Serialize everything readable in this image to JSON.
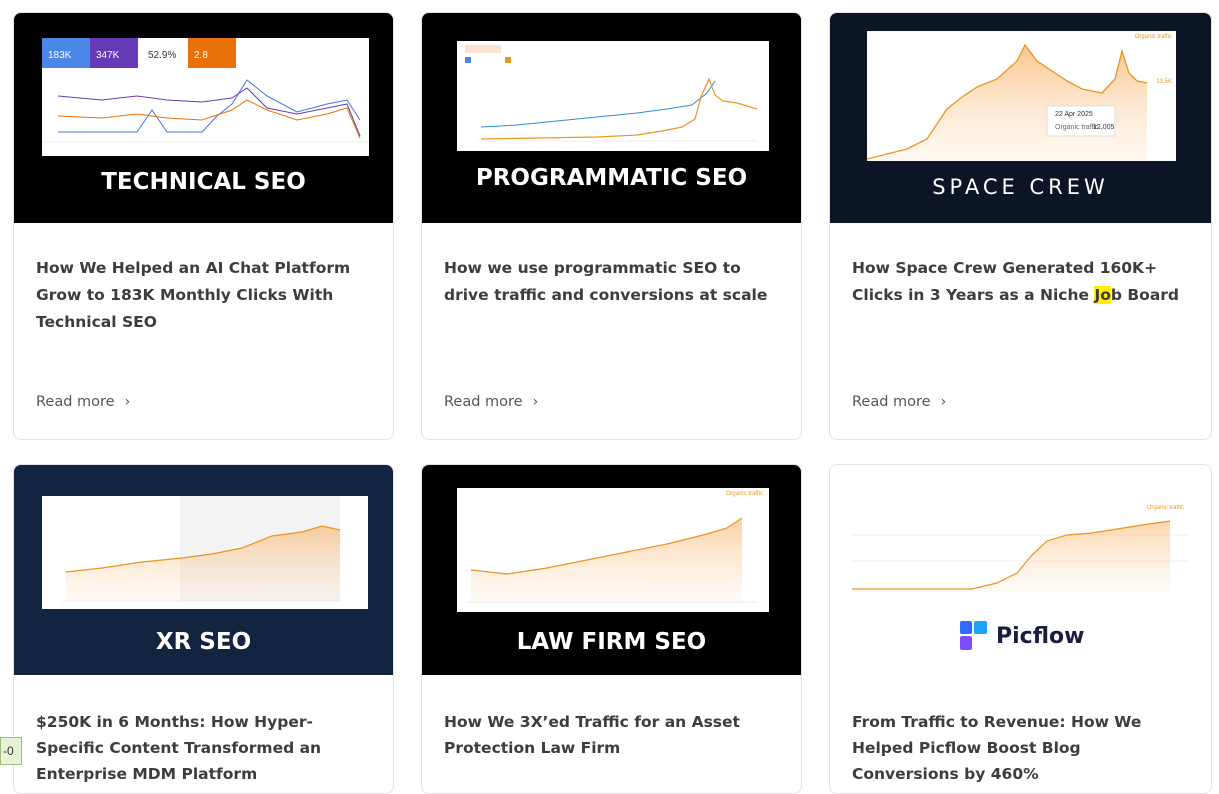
{
  "colors": {
    "highlight": "#ffee00",
    "title_text": "#3d3d3d",
    "chart_orange": "#e8961e",
    "chart_blue": "#2d6fd0",
    "navy_banner": "#0b1526",
    "navy_banner_2": "#132440"
  },
  "cards": [
    {
      "banner_title": "TECHNICAL SEO",
      "title": "How We Helped an AI Chat Platform Grow to 183K Monthly Clicks With Technical SEO",
      "read_more": "Read more",
      "stats": [
        "183K",
        "347K",
        "52.9%",
        "2.8"
      ]
    },
    {
      "banner_title": "PROGRAMMATIC SEO",
      "title": "How we use programmatic SEO to drive traffic and conversions at scale",
      "read_more": "Read more"
    },
    {
      "banner_title": "SPACE CREW",
      "title_pre": "How Space Crew Generated 160K+ Clicks in 3 Years as a Niche ",
      "title_hl": "Jo",
      "title_post": "b Board",
      "read_more": "Read more",
      "tooltip_date": "22 Apr 2025",
      "tooltip_label": "Organic traffic",
      "tooltip_value": "12,005",
      "chart_label": "Organic traffic",
      "axis_value": "13.5K"
    },
    {
      "banner_title": "XR SEO",
      "title": "$250K in 6 Months: How Hyper-Specific Content Transformed an Enterprise MDM Platform"
    },
    {
      "banner_title": "LAW FIRM SEO",
      "title": "How We 3X’ed Traffic for an Asset Protection Law Firm",
      "chart_label": "Organic traffic"
    },
    {
      "logo_text": "Picflow",
      "title": "From Traffic to Revenue: How We Helped Picflow Boost Blog Conversions by 460%",
      "chart_label": "Organic traffic"
    }
  ],
  "side_tab": "-0",
  "icons": {
    "chevron": "chevron-right-icon",
    "logo": "picflow-logo-icon"
  }
}
